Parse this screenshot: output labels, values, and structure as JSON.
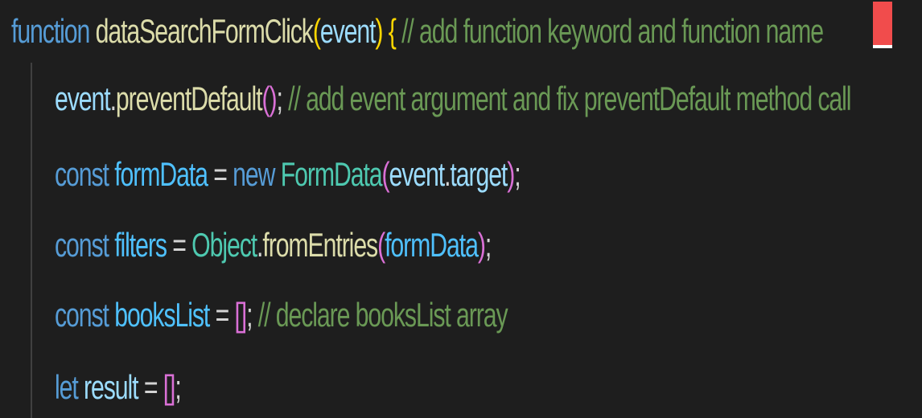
{
  "colors": {
    "background": "#1e1e1e",
    "keyword": "#569cd6",
    "function": "#dcdcaa",
    "variable": "#9cdcfe",
    "constant": "#4fc1ff",
    "class": "#4ec9b0",
    "comment": "#6a9955",
    "bracket_level_1": "#ffd700",
    "bracket_level_2": "#da70d6",
    "bracket_level_3": "#179fff",
    "cursor": "#f14c4c"
  },
  "code": {
    "line1": {
      "kw_function": "function",
      "fn_name": "dataSearchFormClick",
      "paren_open": "(",
      "param": "event",
      "paren_close": ")",
      "brace_open": "{",
      "comment": "// add function keyword and function name"
    },
    "line2": {
      "obj": "event",
      "dot": ".",
      "method": "preventDefault",
      "paren_open": "(",
      "paren_close": ")",
      "semi": ";",
      "comment": "// add event argument and fix preventDefault method call"
    },
    "line3": {
      "kw_const": "const",
      "name": "formData",
      "eq": "=",
      "kw_new": "new",
      "cls": "FormData",
      "paren_open": "(",
      "arg_obj": "event",
      "arg_dot": ".",
      "arg_prop": "target",
      "paren_close": ")",
      "semi": ";"
    },
    "line4": {
      "kw_const": "const",
      "name": "filters",
      "eq": "=",
      "cls": "Object",
      "dot": ".",
      "method": "fromEntries",
      "paren_open": "(",
      "arg": "formData",
      "paren_close": ")",
      "semi": ";"
    },
    "line5": {
      "kw_const": "const",
      "name": "booksList",
      "eq": "=",
      "bracket_open": "[",
      "bracket_close": "]",
      "semi": ";",
      "comment": "// declare booksList array"
    },
    "line6": {
      "kw_let": "let",
      "name": "result",
      "eq": "=",
      "bracket_open": "[",
      "bracket_close": "]",
      "semi": ";"
    }
  }
}
